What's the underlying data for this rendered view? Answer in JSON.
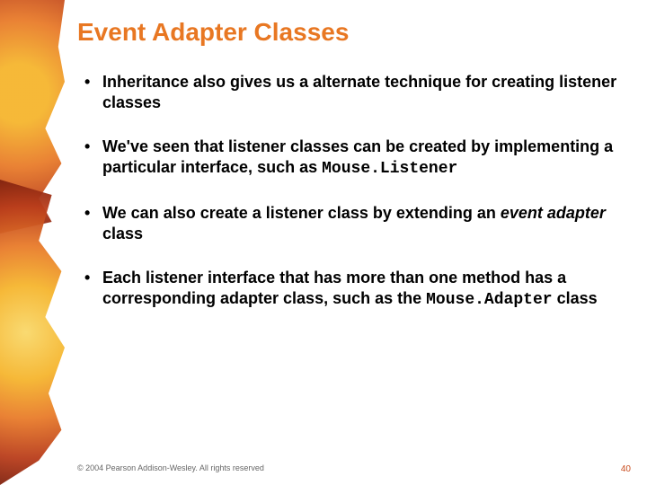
{
  "slide": {
    "title": "Event Adapter Classes",
    "bullets": [
      {
        "pre": "Inheritance also gives us a alternate technique for creating listener classes",
        "code": "",
        "post": ""
      },
      {
        "pre": "We've seen that listener classes can be created by implementing a particular interface, such as ",
        "code": "Mouse.Listener",
        "post": ""
      },
      {
        "pre": "We can also create a listener class by extending an ",
        "italic": "event adapter",
        "post": " class"
      },
      {
        "pre": "Each listener interface that has more than one method has a corresponding adapter class, such as the ",
        "code": "Mouse.Adapter",
        "post": " class"
      }
    ],
    "footer": "© 2004 Pearson Addison-Wesley. All rights reserved",
    "pagenum": "40"
  }
}
